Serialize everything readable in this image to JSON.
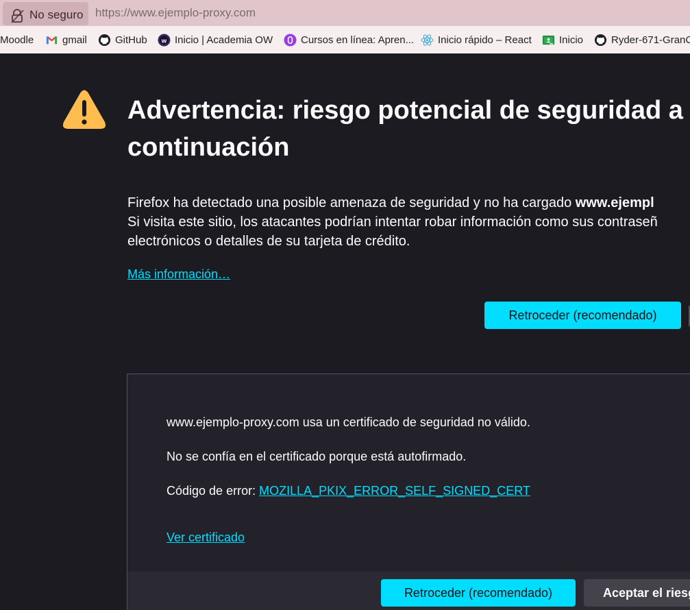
{
  "urlbar": {
    "security_label": "No seguro",
    "url": "https://www.ejemplo-proxy.com"
  },
  "bookmarks": [
    {
      "label": "Moodle",
      "icon": "none"
    },
    {
      "label": "gmail",
      "icon": "gmail-icon"
    },
    {
      "label": "GitHub",
      "icon": "github-icon"
    },
    {
      "label": "Inicio | Academia OW",
      "icon": "academia-ow-icon"
    },
    {
      "label": "Cursos en línea: Apren...",
      "icon": "courses-icon"
    },
    {
      "label": "Inicio rápido – React",
      "icon": "react-icon"
    },
    {
      "label": "Inicio",
      "icon": "classroom-icon"
    },
    {
      "label": "Ryder-671-GranC",
      "icon": "github-icon"
    }
  ],
  "page": {
    "title": "Advertencia: riesgo potencial de seguridad a\ncontinuación",
    "desc_line1_prefix": "Firefox ha detectado una posible amenaza de seguridad y no ha cargado ",
    "desc_line1_bold": "www.ejempl",
    "desc_line2": "Si visita este sitio, los atacantes podrían intentar robar información como sus contraseñ",
    "desc_line3": "electrónicos o detalles de su tarjeta de crédito.",
    "more_info": "Más información…",
    "back_button": "Retroceder (recomendado)"
  },
  "advanced": {
    "line1": "www.ejemplo-proxy.com usa un certificado de seguridad no válido.",
    "line2": "No se confía en el certificado porque está autofirmado.",
    "error_label": "Código de error: ",
    "error_code": "MOZILLA_PKIX_ERROR_SELF_SIGNED_CERT",
    "view_cert": "Ver certificado",
    "back_button": "Retroceder (recomendado)",
    "accept_button": "Aceptar el riesgo y continuar"
  },
  "colors": {
    "background": "#1c1b22",
    "accent": "#00ddff",
    "warning": "#ffbd4f",
    "urlbar": "#e0c6cb"
  }
}
